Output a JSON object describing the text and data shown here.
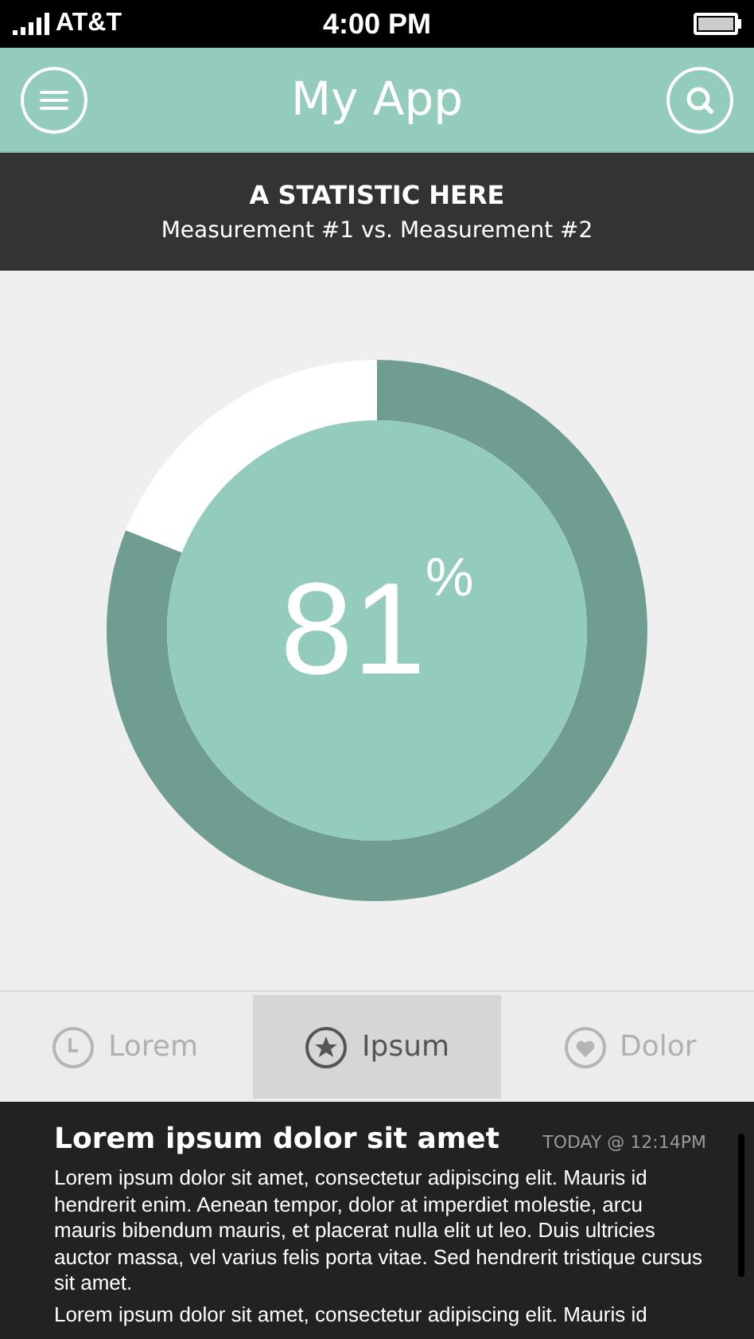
{
  "status_bar": {
    "carrier": "AT&T",
    "time": "4:00 PM"
  },
  "header": {
    "title": "My App"
  },
  "statistic": {
    "title": "A STATISTIC HERE",
    "subtitle": "Measurement #1 vs. Measurement #2",
    "value": "81",
    "unit": "%",
    "level": 0.81
  },
  "tabs": [
    {
      "label": "Lorem",
      "selected": false
    },
    {
      "label": "Ipsum",
      "selected": true
    },
    {
      "label": "Dolor",
      "selected": false
    }
  ],
  "article": {
    "title": "Lorem ipsum dolor sit amet",
    "timestamp": "TODAY @ 12:14PM",
    "paragraphs": [
      "Lorem ipsum dolor sit amet, consectetur adipiscing elit. Mauris id hendrerit enim. Aenean tempor, dolor at imperdiet molestie, arcu mauris bibendum mauris, et placerat nulla elit ut leo. Duis ultricies auctor massa, vel varius felis porta vitae. Sed hendrerit tristique cursus sit amet.",
      "Lorem ipsum dolor sit amet, consectetur adipiscing elit. Mauris id"
    ]
  }
}
